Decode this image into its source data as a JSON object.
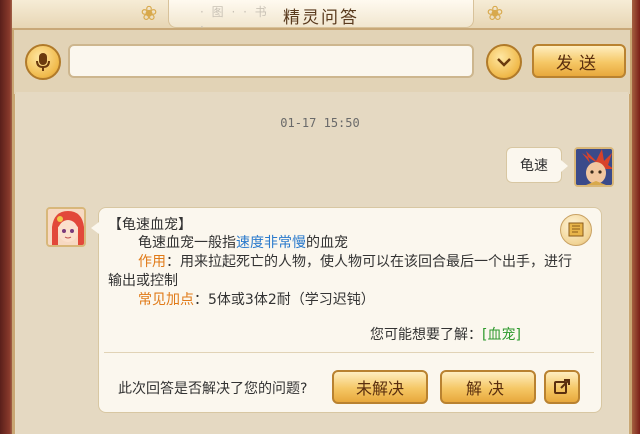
{
  "window": {
    "title": "精灵问答",
    "title_decoration": "· 图 · · 书 ·"
  },
  "input_bar": {
    "mic_icon": "microphone-icon",
    "input_value": "",
    "dropdown_icon": "chevron-down-icon",
    "send_label": "发送"
  },
  "chat": {
    "timestamp": "01-17  15:50",
    "user_message": "龟速",
    "answer": {
      "title": "【龟速血宠】",
      "line1_pre": "龟速血宠一般指",
      "line1_highlight": "速度非常慢",
      "line1_post": "的血宠",
      "line2_label": "作用",
      "line2_text": "：用来拉起死亡的人物，使人物可以在该回合最后一个出手，进行",
      "line3_text": "输出或控制",
      "line4_label": "常见加点",
      "line4_text": "：5体或3体2耐（学习迟钝）",
      "more_prefix": "您可能想要了解：",
      "more_link": "[血宠]"
    },
    "feedback": {
      "question": "此次回答是否解决了您的问题?",
      "unsolved_label": "未解决",
      "solved_label": "解决"
    }
  },
  "colors": {
    "accent_orange": "#e07a18",
    "highlight_blue": "#2a7acc",
    "link_green": "#2e9a2e",
    "button_gold": "#f5c765"
  }
}
